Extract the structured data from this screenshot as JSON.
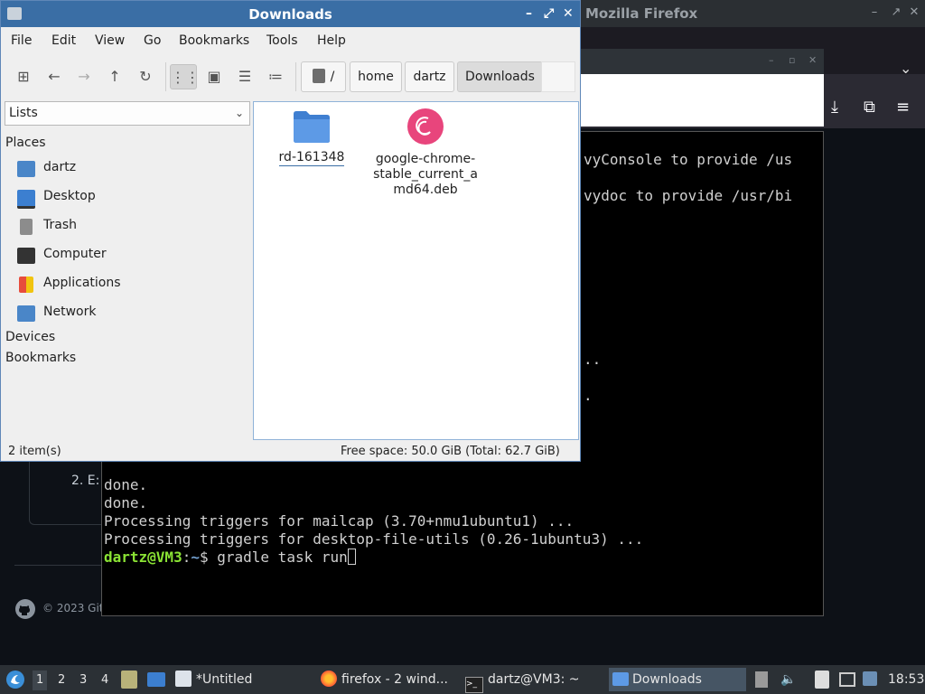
{
  "firefox": {
    "title": "Mozilla Firefox",
    "controls": [
      "–",
      "↗",
      "✕"
    ],
    "tab_chevron": "⌄",
    "github": {
      "step_text": "2. E:",
      "copyright": "© 2023 Gith"
    }
  },
  "terminal": {
    "lines_top": [
      {
        "text": "vyConsole to provide /us"
      },
      {
        "text": "vydoc to provide /usr/bi"
      },
      {
        "text": ".."
      },
      {
        "text": "."
      }
    ],
    "lines": [
      "done.",
      "done.",
      "Processing triggers for mailcap (3.70+nmu1ubuntu1) ...",
      "Processing triggers for desktop-file-utils (0.26-1ubuntu3) ..."
    ],
    "prompt_user": "dartz@VM3",
    "prompt_sep": ":",
    "prompt_path": "~",
    "prompt_symbol": "$ ",
    "command": "gradle task run"
  },
  "file_manager": {
    "title": "Downloads",
    "menu": [
      "File",
      "Edit",
      "View",
      "Go",
      "Bookmarks",
      "Tools",
      "Help"
    ],
    "breadcrumb": {
      "root": "/",
      "items": [
        "home",
        "dartz",
        "Downloads"
      ]
    },
    "side_select": "Lists",
    "places_header": "Places",
    "places": [
      "dartz",
      "Desktop",
      "Trash",
      "Computer",
      "Applications",
      "Network"
    ],
    "devices_header": "Devices",
    "bookmarks_header": "Bookmarks",
    "files": [
      {
        "name": "rd-161348",
        "kind": "folder"
      },
      {
        "name": "google-chrome-stable_current_amd64.deb",
        "line1": "google-chrome-",
        "line2": "stable_current_a",
        "line3": "md64.deb",
        "kind": "debian-package"
      }
    ],
    "status_count": "2 item(s)",
    "status_space": "Free space: 50.0 GiB (Total: 62.7 GiB)",
    "accent": "#3a6ea5"
  },
  "taskbar": {
    "workspaces": [
      "1",
      "2",
      "3",
      "4"
    ],
    "active_workspace": "1",
    "tasks": [
      {
        "label": "*Untitled"
      },
      {
        "label": "firefox - 2 wind..."
      },
      {
        "label": "dartz@VM3: ~"
      },
      {
        "label": "Downloads"
      }
    ],
    "clock": "18:53"
  }
}
